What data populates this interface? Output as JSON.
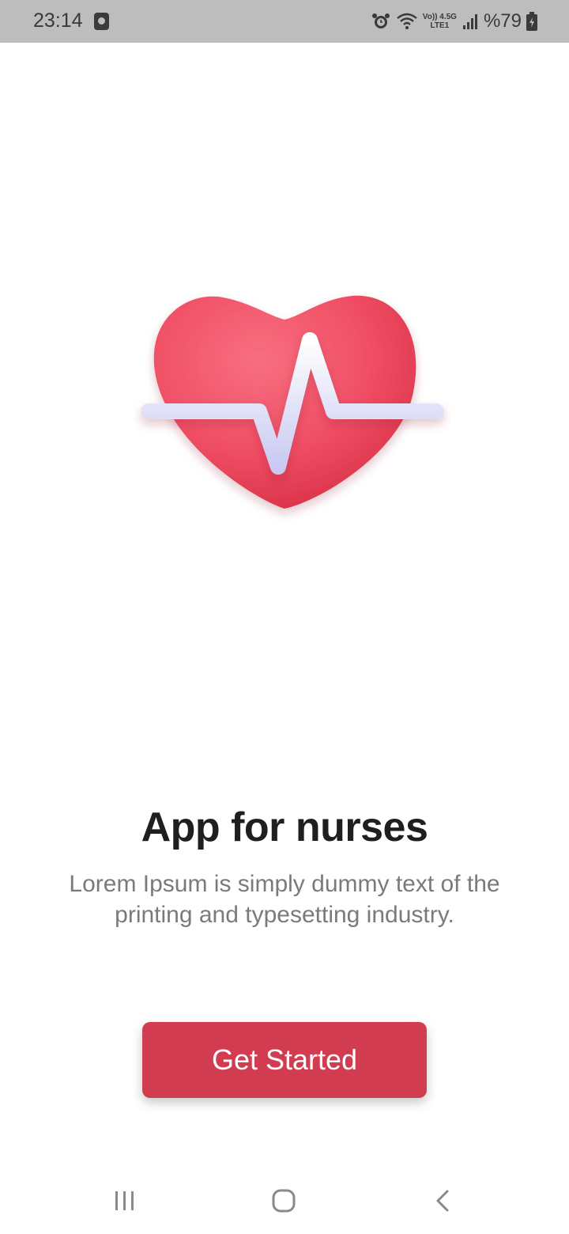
{
  "status_bar": {
    "time": "23:14",
    "network_top": "Vo)) 4.5G",
    "network_bottom": "LTE1",
    "battery": "%79",
    "icons": [
      "media-icon",
      "alarm-icon",
      "wifi-icon",
      "signal-icon",
      "battery-icon"
    ]
  },
  "hero": {
    "icon": "heart-pulse-icon"
  },
  "main": {
    "title": "App for nurses",
    "subtitle": "Lorem Ipsum is simply dummy text of the printing and typesetting industry.",
    "cta_label": "Get Started"
  },
  "nav_bar": {
    "icons": [
      "recents-icon",
      "home-icon",
      "back-icon"
    ]
  },
  "colors": {
    "accent": "#d23c50",
    "status_bar_bg": "#bdbdbd",
    "title": "#1f1f1f",
    "subtitle": "#7a7a7a",
    "heart": "#ef4d63",
    "pulse_line": "#e6e6fa"
  }
}
